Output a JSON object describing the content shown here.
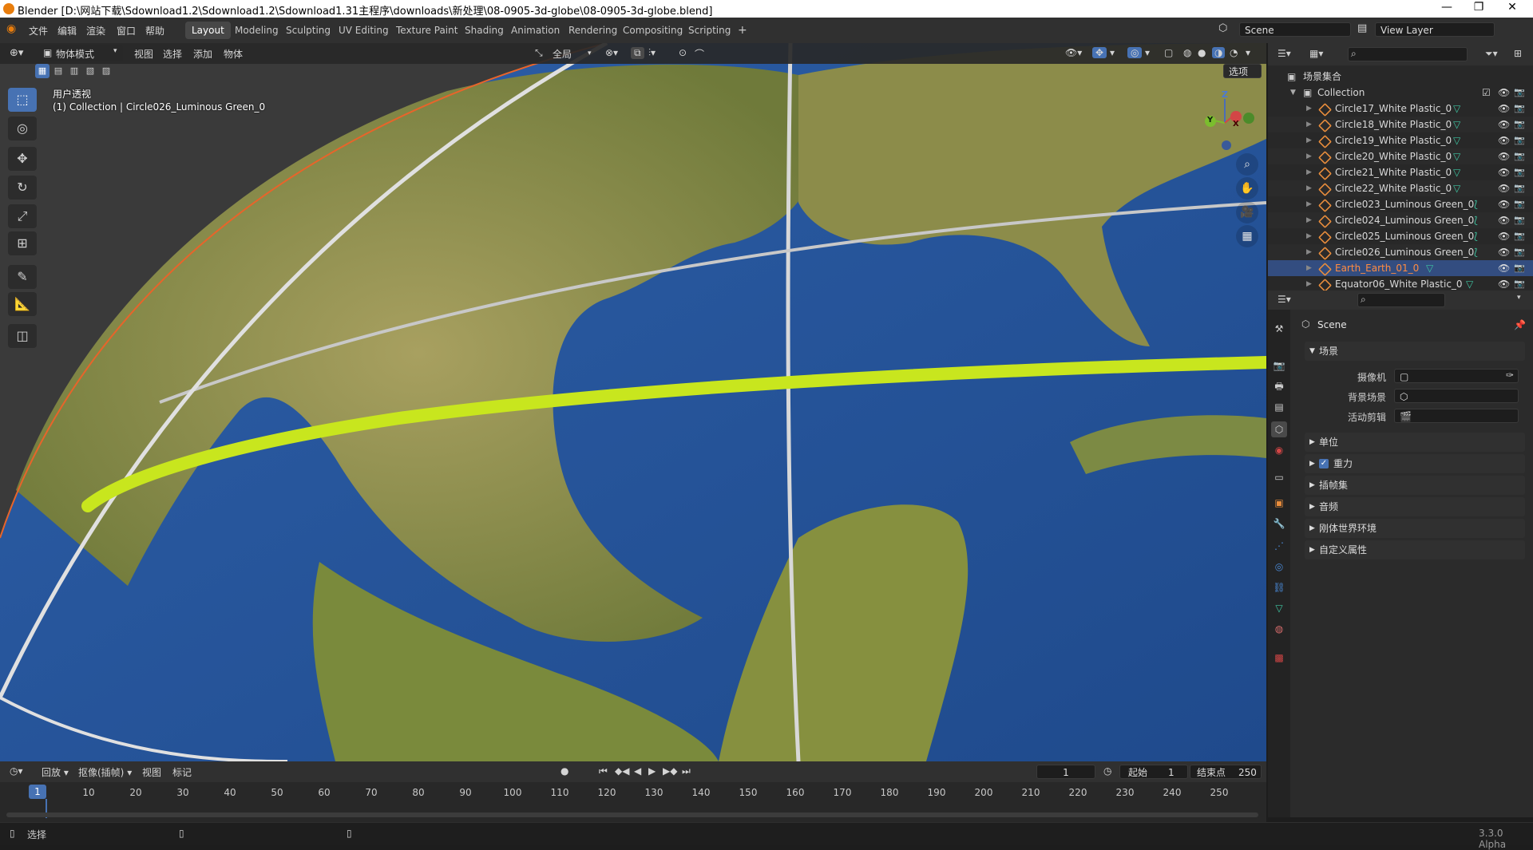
{
  "window": {
    "title": "Blender [D:\\网站下载\\Sdownload1.2\\Sdownload1.2\\Sdownload1.31主程序\\downloads\\新处理\\08-0905-3d-globe\\08-0905-3d-globe.blend]",
    "minimize": "—",
    "maximize": "❐",
    "close": "✕"
  },
  "menu": [
    "文件",
    "编辑",
    "渲染",
    "窗口",
    "帮助"
  ],
  "workspaces": [
    "Layout",
    "Modeling",
    "Sculpting",
    "UV Editing",
    "Texture Paint",
    "Shading",
    "Animation",
    "Rendering",
    "Compositing",
    "Scripting"
  ],
  "workspace_add": "+",
  "scene_field": "Scene",
  "view_layer_field": "View Layer",
  "viewport_header": {
    "mode": "物体模式",
    "items": [
      "视图",
      "选择",
      "添加",
      "物体"
    ],
    "transform_orientation": "全局",
    "options_label": "选项"
  },
  "viewport": {
    "view_name": "用户透视",
    "collection_info": "(1) Collection | Circle026_Luminous Green_0",
    "gizmo_axes": {
      "z": "Z",
      "y": "Y",
      "x": "X"
    }
  },
  "tools": [
    "select-box",
    "cursor",
    "move",
    "rotate",
    "scale",
    "transform",
    "annotate",
    "measure",
    "add-cube"
  ],
  "outliner": {
    "root": "场景集合",
    "collection": "Collection",
    "items": [
      {
        "name": "Circle17_White Plastic_0",
        "selected": false,
        "highlight": false
      },
      {
        "name": "Circle18_White Plastic_0",
        "selected": false,
        "highlight": false
      },
      {
        "name": "Circle19_White Plastic_0",
        "selected": false,
        "highlight": false
      },
      {
        "name": "Circle20_White Plastic_0",
        "selected": false,
        "highlight": false
      },
      {
        "name": "Circle21_White Plastic_0",
        "selected": false,
        "highlight": false
      },
      {
        "name": "Circle22_White Plastic_0",
        "selected": false,
        "highlight": false
      },
      {
        "name": "Circle023_Luminous Green_0",
        "selected": false,
        "highlight": false
      },
      {
        "name": "Circle024_Luminous Green_0",
        "selected": false,
        "highlight": false
      },
      {
        "name": "Circle025_Luminous Green_0",
        "selected": false,
        "highlight": false
      },
      {
        "name": "Circle026_Luminous Green_0",
        "selected": false,
        "highlight": false
      },
      {
        "name": "Earth_Earth_01_0",
        "selected": true,
        "highlight": true
      },
      {
        "name": "Equator06_White Plastic_0",
        "selected": false,
        "highlight": false
      }
    ]
  },
  "properties": {
    "header": "Scene",
    "section_scene": "场景",
    "fields": [
      {
        "label": "摄像机"
      },
      {
        "label": "背景场景"
      },
      {
        "label": "活动剪辑"
      }
    ],
    "sections": [
      {
        "label": "单位",
        "checkbox": false
      },
      {
        "label": "重力",
        "checkbox": true
      },
      {
        "label": "插帧集",
        "checkbox": false
      },
      {
        "label": "音频",
        "checkbox": false
      },
      {
        "label": "刚体世界环境",
        "checkbox": false
      },
      {
        "label": "自定义属性",
        "checkbox": false
      }
    ]
  },
  "timeline": {
    "playback": "回放",
    "keying": "抠像(插帧)",
    "view": "视图",
    "marker": "标记",
    "current_frame": "1",
    "start_label": "起始",
    "start": "1",
    "end_label": "结束点",
    "end": "250",
    "ticks": [
      "10",
      "20",
      "30",
      "40",
      "50",
      "60",
      "70",
      "80",
      "90",
      "100",
      "110",
      "120",
      "130",
      "140",
      "150",
      "160",
      "170",
      "180",
      "190",
      "200",
      "210",
      "220",
      "230",
      "240",
      "250"
    ]
  },
  "status": {
    "select": "选择",
    "version": "3.3.0 Alpha"
  },
  "colors": {
    "accent": "#4772b3",
    "selected_row": "#334d80",
    "selected_text": "#ff8c42",
    "green_ring": "#c8e61e",
    "ocean": "#2a5aa0"
  }
}
